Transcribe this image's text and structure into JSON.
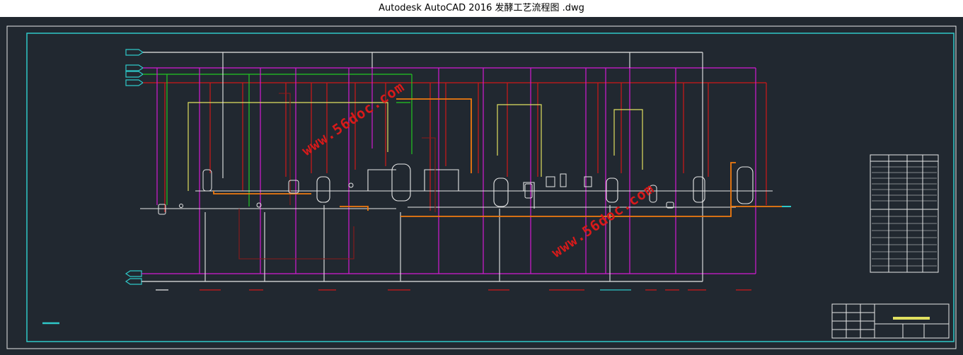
{
  "window": {
    "title": "Autodesk AutoCAD 2016     发酵工艺流程图 .dwg"
  },
  "watermarks": {
    "upper": "www.56doc.com",
    "lower": "www.56doc.com"
  },
  "colors": {
    "background": "#212830",
    "border_cyan": "#2fc8c8",
    "steam_red": "#d01818",
    "magenta": "#d21ad2",
    "green": "#22c822",
    "yellow": "#e0e060",
    "orange": "#f07a10",
    "white": "#e8e8e8"
  },
  "icons": [
    "equipment-tank-icon",
    "fermenter-vessel-icon",
    "pump-icon",
    "arrow-inlet-icon",
    "arrow-outlet-icon"
  ]
}
